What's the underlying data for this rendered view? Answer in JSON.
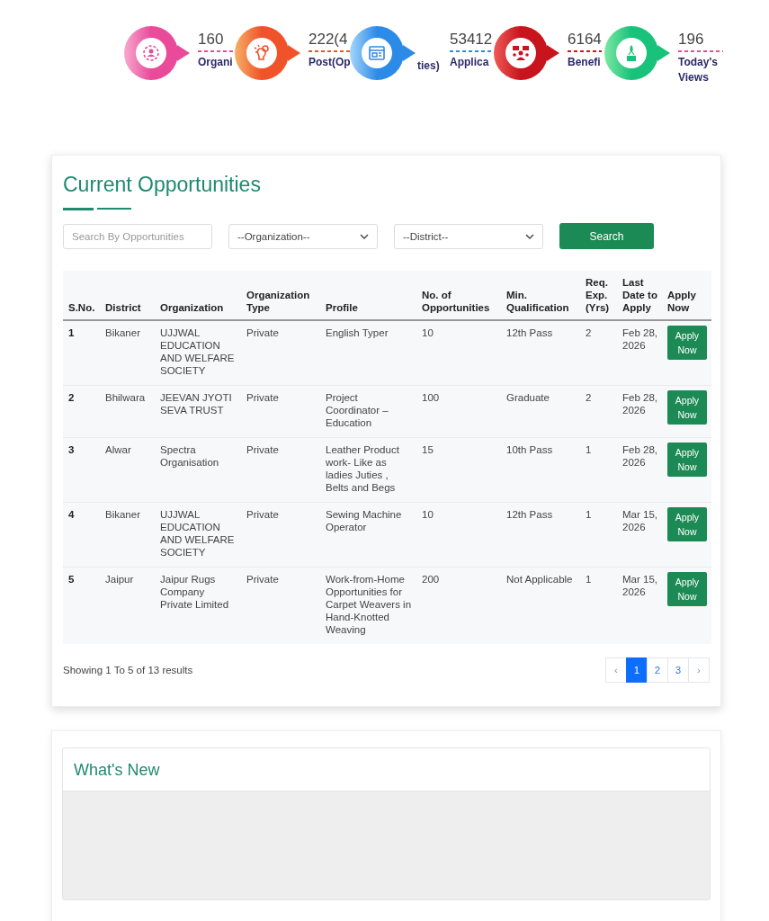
{
  "stats": [
    {
      "value": "160",
      "label": "Organi",
      "color": "#e94a9a"
    },
    {
      "value": "222(4",
      "label": "Post(Op",
      "label_tail": "ties)",
      "color": "#f0522a"
    },
    {
      "value": "53412",
      "label": "Applica",
      "color": "#2d8be8"
    },
    {
      "value": "6164",
      "label": "Benefi",
      "color": "#d0181f"
    },
    {
      "value": "196",
      "label": "Today's Views",
      "color": "#e94a9a"
    }
  ],
  "opportunities": {
    "title": "Current Opportunities",
    "search": {
      "placeholder": "Search By Opportunities"
    },
    "filters": [
      "--Organization--",
      "--District--"
    ],
    "search_button": "Search",
    "columns": [
      "S.No.",
      "District",
      "Organization",
      "Organization Type",
      "Profile",
      "No. of Opportunities",
      "Min. Qualification",
      "Req. Exp. (Yrs)",
      "Last Date to Apply",
      "Apply Now"
    ],
    "rows": [
      {
        "cells": [
          "1",
          "Bikaner",
          "UJJWAL EDUCATION AND WELFARE SOCIETY",
          "Private",
          "English Typer",
          "10",
          "12th Pass",
          "2",
          "Feb 28, 2026"
        ],
        "action": "Apply Now"
      },
      {
        "cells": [
          "2",
          "Bhilwara",
          "JEEVAN JYOTI SEVA TRUST",
          "Private",
          "Project Coordinator – Education",
          "100",
          "Graduate",
          "2",
          "Feb 28, 2026"
        ],
        "action": "Apply Now"
      },
      {
        "cells": [
          "3",
          "Alwar",
          "Spectra Organisation",
          "Private",
          "Leather Product work- Like as ladies Juties , Belts and Begs",
          "15",
          "10th Pass",
          "1",
          "Feb 28, 2026"
        ],
        "action": "Apply Now"
      },
      {
        "cells": [
          "4",
          "Bikaner",
          "UJJWAL EDUCATION AND WELFARE SOCIETY",
          "Private",
          "Sewing Machine Operator",
          "10",
          "12th Pass",
          "1",
          "Mar 15, 2026"
        ],
        "action": "Apply Now"
      },
      {
        "cells": [
          "5",
          "Jaipur",
          "Jaipur Rugs Company Private Limited",
          "Private",
          "Work-from-Home Opportunities for Carpet Weavers in Hand-Knotted Weaving",
          "200",
          "Not Applicable",
          "1",
          "Mar 15, 2026"
        ],
        "action": "Apply Now"
      }
    ],
    "summary": "Showing 1 To 5 of 13 results",
    "pagination": [
      {
        "label": "‹",
        "kind": "prev",
        "selected": false
      },
      {
        "label": "1",
        "kind": "page",
        "selected": true
      },
      {
        "label": "2",
        "kind": "page",
        "selected": false
      },
      {
        "label": "3",
        "kind": "page",
        "selected": false
      },
      {
        "label": "›",
        "kind": "next",
        "selected": false
      }
    ]
  },
  "whats_new": {
    "title": "What's New"
  }
}
